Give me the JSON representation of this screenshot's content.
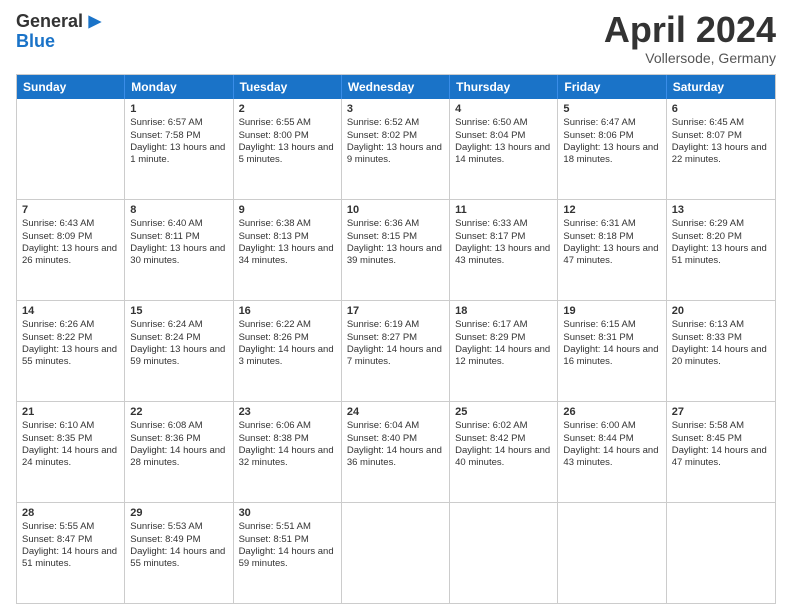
{
  "logo": {
    "line1": "General",
    "line2": "Blue"
  },
  "title": "April 2024",
  "subtitle": "Vollersode, Germany",
  "header_days": [
    "Sunday",
    "Monday",
    "Tuesday",
    "Wednesday",
    "Thursday",
    "Friday",
    "Saturday"
  ],
  "rows": [
    [
      {
        "day": "",
        "sunrise": "",
        "sunset": "",
        "daylight": ""
      },
      {
        "day": "1",
        "sunrise": "Sunrise: 6:57 AM",
        "sunset": "Sunset: 7:58 PM",
        "daylight": "Daylight: 13 hours and 1 minute."
      },
      {
        "day": "2",
        "sunrise": "Sunrise: 6:55 AM",
        "sunset": "Sunset: 8:00 PM",
        "daylight": "Daylight: 13 hours and 5 minutes."
      },
      {
        "day": "3",
        "sunrise": "Sunrise: 6:52 AM",
        "sunset": "Sunset: 8:02 PM",
        "daylight": "Daylight: 13 hours and 9 minutes."
      },
      {
        "day": "4",
        "sunrise": "Sunrise: 6:50 AM",
        "sunset": "Sunset: 8:04 PM",
        "daylight": "Daylight: 13 hours and 14 minutes."
      },
      {
        "day": "5",
        "sunrise": "Sunrise: 6:47 AM",
        "sunset": "Sunset: 8:06 PM",
        "daylight": "Daylight: 13 hours and 18 minutes."
      },
      {
        "day": "6",
        "sunrise": "Sunrise: 6:45 AM",
        "sunset": "Sunset: 8:07 PM",
        "daylight": "Daylight: 13 hours and 22 minutes."
      }
    ],
    [
      {
        "day": "7",
        "sunrise": "Sunrise: 6:43 AM",
        "sunset": "Sunset: 8:09 PM",
        "daylight": "Daylight: 13 hours and 26 minutes."
      },
      {
        "day": "8",
        "sunrise": "Sunrise: 6:40 AM",
        "sunset": "Sunset: 8:11 PM",
        "daylight": "Daylight: 13 hours and 30 minutes."
      },
      {
        "day": "9",
        "sunrise": "Sunrise: 6:38 AM",
        "sunset": "Sunset: 8:13 PM",
        "daylight": "Daylight: 13 hours and 34 minutes."
      },
      {
        "day": "10",
        "sunrise": "Sunrise: 6:36 AM",
        "sunset": "Sunset: 8:15 PM",
        "daylight": "Daylight: 13 hours and 39 minutes."
      },
      {
        "day": "11",
        "sunrise": "Sunrise: 6:33 AM",
        "sunset": "Sunset: 8:17 PM",
        "daylight": "Daylight: 13 hours and 43 minutes."
      },
      {
        "day": "12",
        "sunrise": "Sunrise: 6:31 AM",
        "sunset": "Sunset: 8:18 PM",
        "daylight": "Daylight: 13 hours and 47 minutes."
      },
      {
        "day": "13",
        "sunrise": "Sunrise: 6:29 AM",
        "sunset": "Sunset: 8:20 PM",
        "daylight": "Daylight: 13 hours and 51 minutes."
      }
    ],
    [
      {
        "day": "14",
        "sunrise": "Sunrise: 6:26 AM",
        "sunset": "Sunset: 8:22 PM",
        "daylight": "Daylight: 13 hours and 55 minutes."
      },
      {
        "day": "15",
        "sunrise": "Sunrise: 6:24 AM",
        "sunset": "Sunset: 8:24 PM",
        "daylight": "Daylight: 13 hours and 59 minutes."
      },
      {
        "day": "16",
        "sunrise": "Sunrise: 6:22 AM",
        "sunset": "Sunset: 8:26 PM",
        "daylight": "Daylight: 14 hours and 3 minutes."
      },
      {
        "day": "17",
        "sunrise": "Sunrise: 6:19 AM",
        "sunset": "Sunset: 8:27 PM",
        "daylight": "Daylight: 14 hours and 7 minutes."
      },
      {
        "day": "18",
        "sunrise": "Sunrise: 6:17 AM",
        "sunset": "Sunset: 8:29 PM",
        "daylight": "Daylight: 14 hours and 12 minutes."
      },
      {
        "day": "19",
        "sunrise": "Sunrise: 6:15 AM",
        "sunset": "Sunset: 8:31 PM",
        "daylight": "Daylight: 14 hours and 16 minutes."
      },
      {
        "day": "20",
        "sunrise": "Sunrise: 6:13 AM",
        "sunset": "Sunset: 8:33 PM",
        "daylight": "Daylight: 14 hours and 20 minutes."
      }
    ],
    [
      {
        "day": "21",
        "sunrise": "Sunrise: 6:10 AM",
        "sunset": "Sunset: 8:35 PM",
        "daylight": "Daylight: 14 hours and 24 minutes."
      },
      {
        "day": "22",
        "sunrise": "Sunrise: 6:08 AM",
        "sunset": "Sunset: 8:36 PM",
        "daylight": "Daylight: 14 hours and 28 minutes."
      },
      {
        "day": "23",
        "sunrise": "Sunrise: 6:06 AM",
        "sunset": "Sunset: 8:38 PM",
        "daylight": "Daylight: 14 hours and 32 minutes."
      },
      {
        "day": "24",
        "sunrise": "Sunrise: 6:04 AM",
        "sunset": "Sunset: 8:40 PM",
        "daylight": "Daylight: 14 hours and 36 minutes."
      },
      {
        "day": "25",
        "sunrise": "Sunrise: 6:02 AM",
        "sunset": "Sunset: 8:42 PM",
        "daylight": "Daylight: 14 hours and 40 minutes."
      },
      {
        "day": "26",
        "sunrise": "Sunrise: 6:00 AM",
        "sunset": "Sunset: 8:44 PM",
        "daylight": "Daylight: 14 hours and 43 minutes."
      },
      {
        "day": "27",
        "sunrise": "Sunrise: 5:58 AM",
        "sunset": "Sunset: 8:45 PM",
        "daylight": "Daylight: 14 hours and 47 minutes."
      }
    ],
    [
      {
        "day": "28",
        "sunrise": "Sunrise: 5:55 AM",
        "sunset": "Sunset: 8:47 PM",
        "daylight": "Daylight: 14 hours and 51 minutes."
      },
      {
        "day": "29",
        "sunrise": "Sunrise: 5:53 AM",
        "sunset": "Sunset: 8:49 PM",
        "daylight": "Daylight: 14 hours and 55 minutes."
      },
      {
        "day": "30",
        "sunrise": "Sunrise: 5:51 AM",
        "sunset": "Sunset: 8:51 PM",
        "daylight": "Daylight: 14 hours and 59 minutes."
      },
      {
        "day": "",
        "sunrise": "",
        "sunset": "",
        "daylight": ""
      },
      {
        "day": "",
        "sunrise": "",
        "sunset": "",
        "daylight": ""
      },
      {
        "day": "",
        "sunrise": "",
        "sunset": "",
        "daylight": ""
      },
      {
        "day": "",
        "sunrise": "",
        "sunset": "",
        "daylight": ""
      }
    ]
  ]
}
